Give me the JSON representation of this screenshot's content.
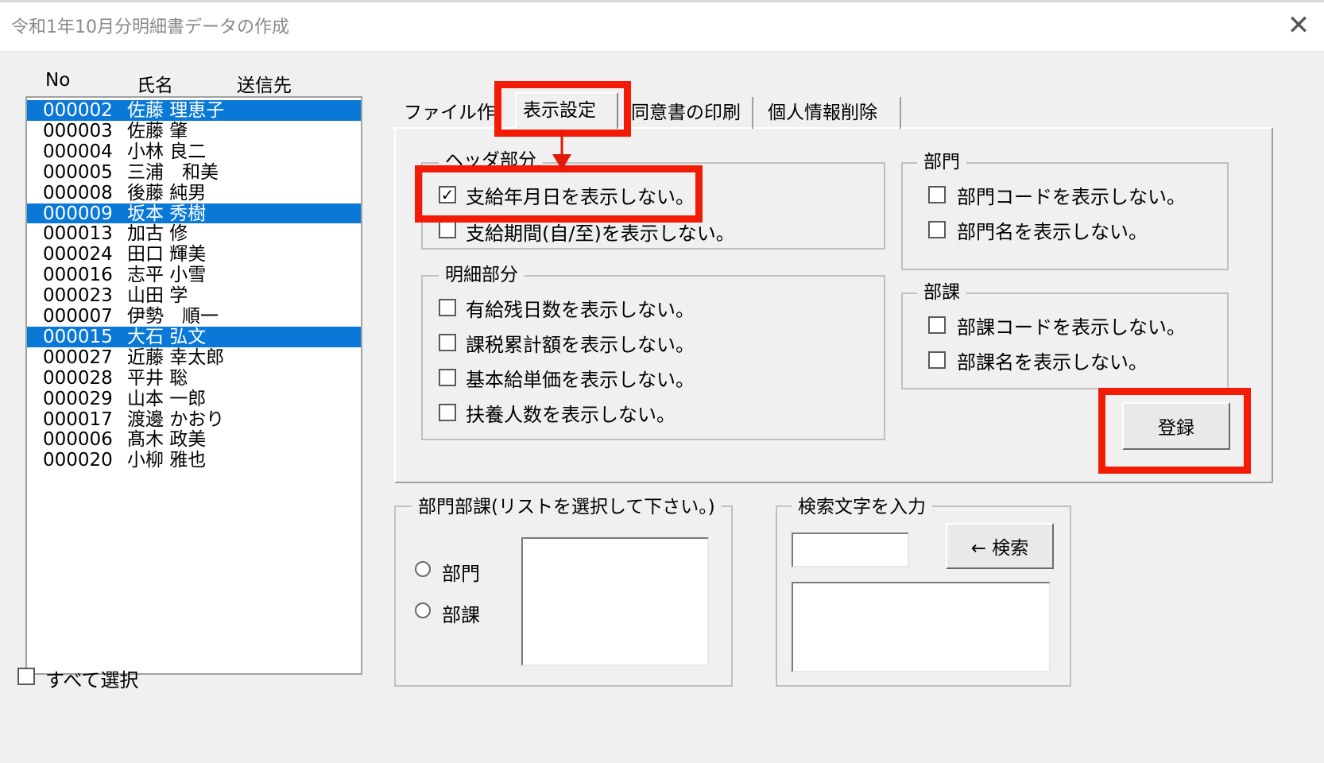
{
  "window": {
    "title": "令和1年10月分明細書データの作成",
    "close_label": "✕"
  },
  "list": {
    "headers": [
      "No",
      "氏名",
      "送信先"
    ],
    "rows": [
      {
        "no": "000002",
        "name": "佐藤 理恵子",
        "selected": true
      },
      {
        "no": "000003",
        "name": "佐藤 肇",
        "selected": false
      },
      {
        "no": "000004",
        "name": "小林 良二",
        "selected": false
      },
      {
        "no": "000005",
        "name": "三浦　和美",
        "selected": false
      },
      {
        "no": "000008",
        "name": "後藤 純男",
        "selected": false
      },
      {
        "no": "000009",
        "name": "坂本 秀樹",
        "selected": true
      },
      {
        "no": "000013",
        "name": "加古 修",
        "selected": false
      },
      {
        "no": "000024",
        "name": "田口 輝美",
        "selected": false
      },
      {
        "no": "000016",
        "name": "志平 小雪",
        "selected": false
      },
      {
        "no": "000023",
        "name": "山田 学",
        "selected": false
      },
      {
        "no": "000007",
        "name": "伊勢　順一",
        "selected": false
      },
      {
        "no": "000015",
        "name": "大石 弘文",
        "selected": true
      },
      {
        "no": "000027",
        "name": "近藤 幸太郎",
        "selected": false
      },
      {
        "no": "000028",
        "name": "平井 聡",
        "selected": false
      },
      {
        "no": "000029",
        "name": "山本 一郎",
        "selected": false
      },
      {
        "no": "000017",
        "name": "渡邊 かおり",
        "selected": false
      },
      {
        "no": "000006",
        "name": "髙木 政美",
        "selected": false
      },
      {
        "no": "000020",
        "name": "小柳 雅也",
        "selected": false
      }
    ],
    "select_all_label": "すべて選択"
  },
  "tabs": [
    {
      "label": "ファイル作成",
      "active": false
    },
    {
      "label": "表示設定",
      "active": true
    },
    {
      "label": "同意書の印刷",
      "active": false
    },
    {
      "label": "個人情報削除",
      "active": false
    }
  ],
  "header_section": {
    "legend": "ヘッダ部分",
    "options": [
      {
        "label": "支給年月日を表示しない。",
        "checked": true
      },
      {
        "label": "支給期間(自/至)を表示しない。",
        "checked": false
      }
    ]
  },
  "detail_section": {
    "legend": "明細部分",
    "options": [
      {
        "label": "有給残日数を表示しない。",
        "checked": false
      },
      {
        "label": "課税累計額を表示しない。",
        "checked": false
      },
      {
        "label": "基本給単価を表示しない。",
        "checked": false
      },
      {
        "label": "扶養人数を表示しない。",
        "checked": false
      }
    ]
  },
  "dept_section": {
    "legend": "部門",
    "options": [
      {
        "label": "部門コードを表示しない。",
        "checked": false
      },
      {
        "label": "部門名を表示しない。",
        "checked": false
      }
    ]
  },
  "section_section": {
    "legend": "部課",
    "options": [
      {
        "label": "部課コードを表示しない。",
        "checked": false
      },
      {
        "label": "部課名を表示しない。",
        "checked": false
      }
    ]
  },
  "register_label": "登録",
  "dept_filter": {
    "legend": "部門部課(リストを選択して下さい。)",
    "radio_dept": "部門",
    "radio_section": "部課"
  },
  "search": {
    "legend": "検索文字を入力",
    "input_value": "",
    "button_label": "← 検索"
  },
  "colors": {
    "selection": "#0a78d7",
    "highlight": "#f31b05"
  }
}
